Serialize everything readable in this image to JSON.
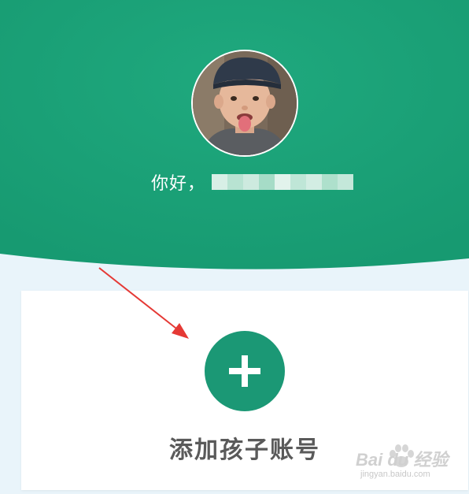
{
  "header": {
    "greeting": "你好，",
    "background_color": "#1ba377",
    "page_background": "#e9f4fa"
  },
  "avatar": {
    "description_icon": "user-avatar-photo"
  },
  "blurred_name": {
    "colors": [
      "#d8efe6",
      "#b8e3d2",
      "#cdeadf",
      "#a6dcc7",
      "#e2f3ec",
      "#bfe6d7",
      "#d3ede3",
      "#aee0cc",
      "#c4e8da"
    ]
  },
  "add_child": {
    "label": "添加孩子账号",
    "button_color": "#1b9875",
    "icon": "plus-icon"
  },
  "annotation": {
    "arrow_color": "#e53935",
    "icon": "arrow-annotation"
  },
  "watermark": {
    "brand": "Bai du 经验",
    "url": "jingyan.baidu.com"
  }
}
